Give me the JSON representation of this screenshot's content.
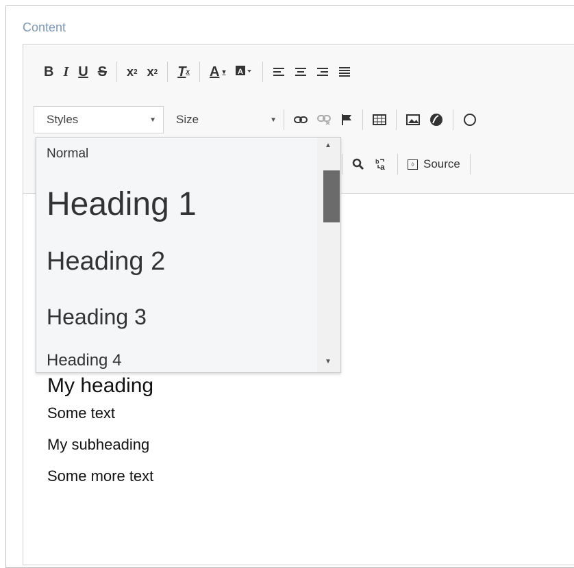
{
  "content_label": "Content",
  "toolbar": {
    "styles_label": "Styles",
    "size_label": "Size",
    "source_label": "Source"
  },
  "dropdown": {
    "items": [
      "Normal",
      "Heading 1",
      "Heading 2",
      "Heading 3",
      "Heading 4"
    ]
  },
  "editor_body": {
    "heading": "My heading",
    "text1": "Some text",
    "subheading": "My subheading",
    "text2": "Some more text"
  },
  "colors": {
    "label": "#7b98b6",
    "toolbar_bg": "#f8f8f8",
    "dropdown_bg": "#f4f6f8",
    "scrollbar_thumb": "#6b6b6b"
  }
}
